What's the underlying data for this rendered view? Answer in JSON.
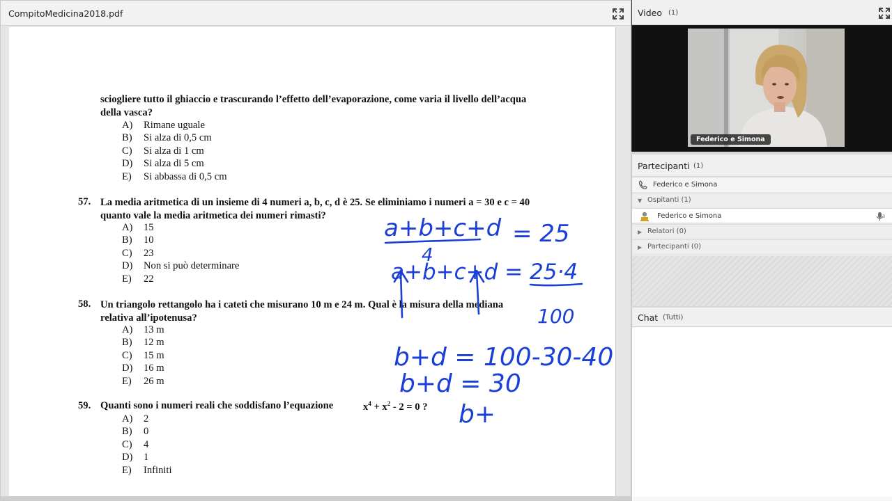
{
  "pdf_pod": {
    "title": "CompitoMedicina2018.pdf",
    "question_56": {
      "text_line1": "sciogliere tutto il ghiaccio e trascurando l’effetto dell’evaporazione, come varia il livello dell’acqua",
      "text_line2": "della vasca?",
      "options": [
        {
          "letter": "A)",
          "text": "Rimane uguale"
        },
        {
          "letter": "B)",
          "text": "Si alza di 0,5 cm"
        },
        {
          "letter": "C)",
          "text": "Si alza di 1 cm"
        },
        {
          "letter": "D)",
          "text": "Si alza di 5 cm"
        },
        {
          "letter": "E)",
          "text": "Si abbassa di 0,5 cm"
        }
      ]
    },
    "question_57": {
      "number": "57.",
      "text_line1": "La media aritmetica di un insieme di 4 numeri a, b, c, d è 25. Se eliminiamo i numeri a = 30 e c = 40",
      "text_line2": "quanto vale la media aritmetica dei numeri rimasti?",
      "options": [
        {
          "letter": "A)",
          "text": "15"
        },
        {
          "letter": "B)",
          "text": "10"
        },
        {
          "letter": "C)",
          "text": "23"
        },
        {
          "letter": "D)",
          "text": "Non si può determinare"
        },
        {
          "letter": "E)",
          "text": "22"
        }
      ]
    },
    "question_58": {
      "number": "58.",
      "text_line1": "Un triangolo rettangolo ha i cateti che misurano 10 m e 24 m. Qual è la misura della mediana",
      "text_line2": "relativa all’ipotenusa?",
      "options": [
        {
          "letter": "A)",
          "text": "13 m"
        },
        {
          "letter": "B)",
          "text": "12 m"
        },
        {
          "letter": "C)",
          "text": "15 m"
        },
        {
          "letter": "D)",
          "text": "16 m"
        },
        {
          "letter": "E)",
          "text": "26 m"
        }
      ]
    },
    "question_59": {
      "number": "59.",
      "text": "Quanti sono i numeri reali che soddisfano l’equazione",
      "equation": {
        "x": "x",
        "exp4": "4",
        "plus": " + x",
        "exp2": "2",
        "rest": " - 2 = 0 ?"
      },
      "options": [
        {
          "letter": "A)",
          "text": "2"
        },
        {
          "letter": "B)",
          "text": "0"
        },
        {
          "letter": "C)",
          "text": "4"
        },
        {
          "letter": "D)",
          "text": "1"
        },
        {
          "letter": "E)",
          "text": "Infiniti"
        }
      ]
    },
    "handwriting": {
      "line1_numerator": "a+b+c+d",
      "line1_rhs": "= 25",
      "line1_denominator": "4",
      "line2": "a+b+c+d = 25·4",
      "line2_result": "100",
      "line3": "b+d = 100-30-40",
      "line4": "b+d = 30",
      "line5": "b+",
      "ink_color": "#1a3fd6"
    }
  },
  "video_pod": {
    "title": "Video",
    "count": "(1)",
    "speaker_label": "Federico e Simona"
  },
  "participants_pod": {
    "title": "Partecipanti",
    "count": "(1)",
    "host_name": "Federico e Simona",
    "groups": [
      {
        "label": "Ospitanti (1)",
        "expanded": true
      },
      {
        "label": "Relatori (0)",
        "expanded": false
      },
      {
        "label": "Partecipanti (0)",
        "expanded": false
      }
    ],
    "members": [
      {
        "name": "Federico e Simona"
      }
    ]
  },
  "chat_pod": {
    "title": "Chat",
    "scope": "(Tutti)"
  }
}
